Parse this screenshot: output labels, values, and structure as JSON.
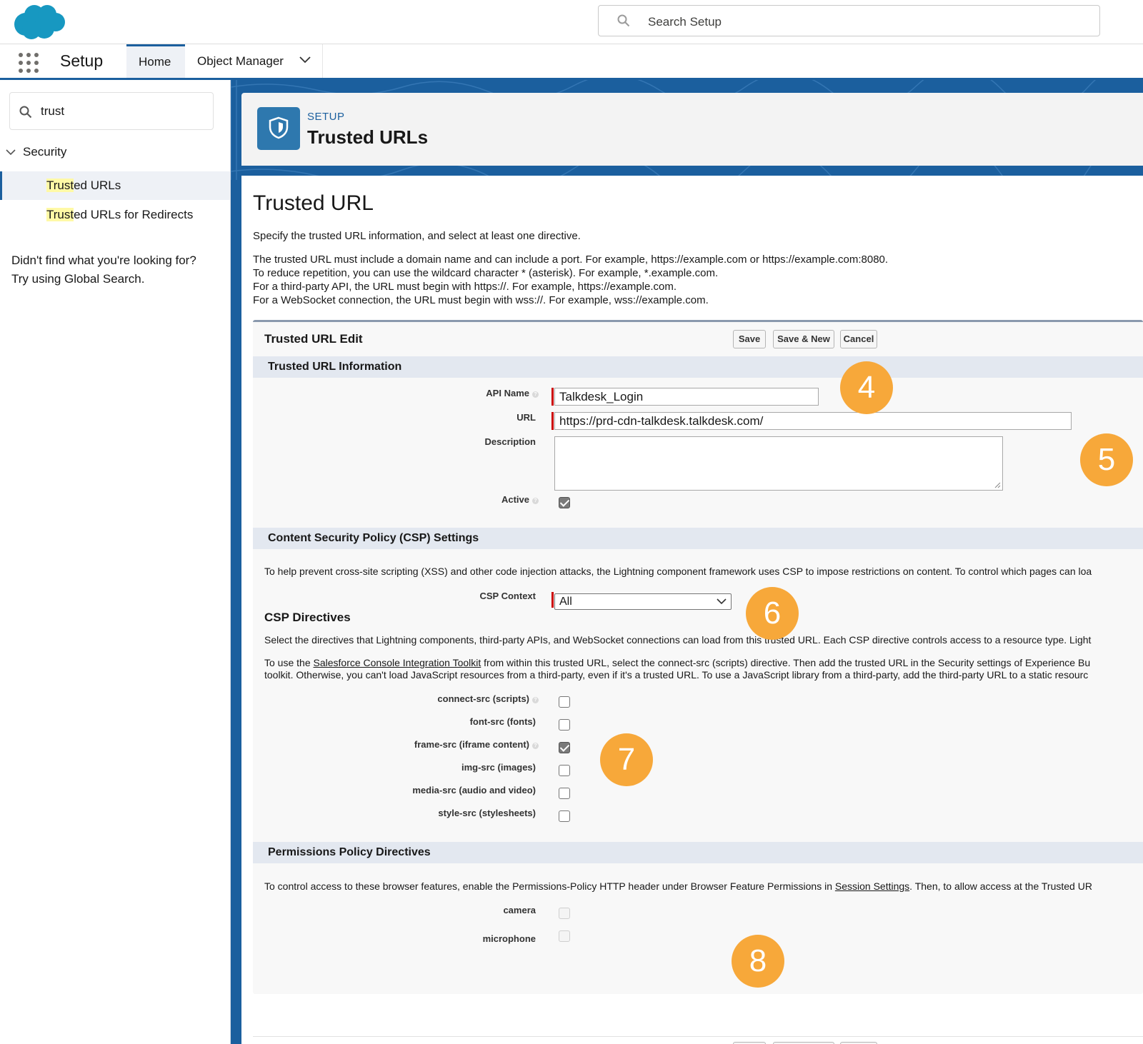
{
  "header": {
    "search_placeholder": "Search Setup"
  },
  "nav": {
    "app_name": "Setup",
    "tabs": [
      {
        "label": "Home"
      },
      {
        "label": "Object Manager"
      }
    ]
  },
  "sidebar": {
    "quickfind_value": "trust",
    "section": "Security",
    "items": [
      {
        "match": "Trust",
        "rest": "ed URLs"
      },
      {
        "match": "Trust",
        "rest": "ed URLs for Redirects"
      }
    ],
    "notfound_line1": "Didn't find what you're looking for?",
    "notfound_line2": "Try using Global Search."
  },
  "page_header": {
    "subtitle": "SETUP",
    "title": "Trusted URLs"
  },
  "page": {
    "title": "Trusted URL",
    "desc": "Specify the trusted URL information, and select at least one directive.",
    "info": [
      "The trusted URL must include a domain name and can include a port. For example, https://example.com or https://example.com:8080.",
      "To reduce repetition, you can use the wildcard character * (asterisk). For example, *.example.com.",
      "For a third-party API, the URL must begin with https://. For example, https://example.com.",
      "For a WebSocket connection, the URL must begin with wss://. For example, wss://example.com."
    ]
  },
  "edit": {
    "title": "Trusted URL Edit",
    "buttons": {
      "save": "Save",
      "save_new": "Save & New",
      "cancel": "Cancel"
    },
    "info_section": "Trusted URL Information",
    "fields": {
      "api_name_label": "API Name",
      "api_name_value": "Talkdesk_Login",
      "url_label": "URL",
      "url_value": "https://prd-cdn-talkdesk.talkdesk.com/",
      "description_label": "Description",
      "active_label": "Active"
    },
    "csp_section": "Content Security Policy (CSP) Settings",
    "csp_text": "To help prevent cross-site scripting (XSS) and other code injection attacks, the Lightning component framework uses CSP to impose restrictions on content. To control which pages can loa",
    "csp_context_label": "CSP Context",
    "csp_context_value": "All",
    "csp_directives_title": "CSP Directives",
    "csp_directives_text": "Select the directives that Lightning components, third-party APIs, and WebSocket connections can load from this trusted URL. Each CSP directive controls access to a resource type. Light",
    "toolkit_pre": "To use the ",
    "toolkit_link": "Salesforce Console Integration Toolkit",
    "toolkit_post": " from within this trusted URL, select the connect-src (scripts) directive. Then add the trusted URL in the Security settings of Experience Bu",
    "toolkit_line2": "toolkit. Otherwise, you can't load JavaScript resources from a third-party, even if it's a trusted URL. To use a JavaScript library from a third-party, add the third-party URL to a static resourc",
    "directives": [
      {
        "label": "connect-src (scripts)",
        "checked": false,
        "help": true
      },
      {
        "label": "font-src (fonts)",
        "checked": false,
        "help": false
      },
      {
        "label": "frame-src (iframe content)",
        "checked": true,
        "help": true
      },
      {
        "label": "img-src (images)",
        "checked": false,
        "help": false
      },
      {
        "label": "media-src (audio and video)",
        "checked": false,
        "help": false
      },
      {
        "label": "style-src (stylesheets)",
        "checked": false,
        "help": false
      }
    ],
    "perm_section": "Permissions Policy Directives",
    "perm_pre": "To control access to these browser features, enable the Permissions-Policy HTTP header under Browser Feature Permissions in ",
    "perm_link": "Session Settings",
    "perm_post": ". Then, to allow access at the Trusted UR",
    "perm_items": [
      {
        "label": "camera"
      },
      {
        "label": "microphone"
      }
    ]
  },
  "badges": [
    "4",
    "5",
    "6",
    "7",
    "8"
  ],
  "colors": {
    "brand": "#1b5f9e",
    "badge": "#f7a83a",
    "required": "#cc0000"
  }
}
